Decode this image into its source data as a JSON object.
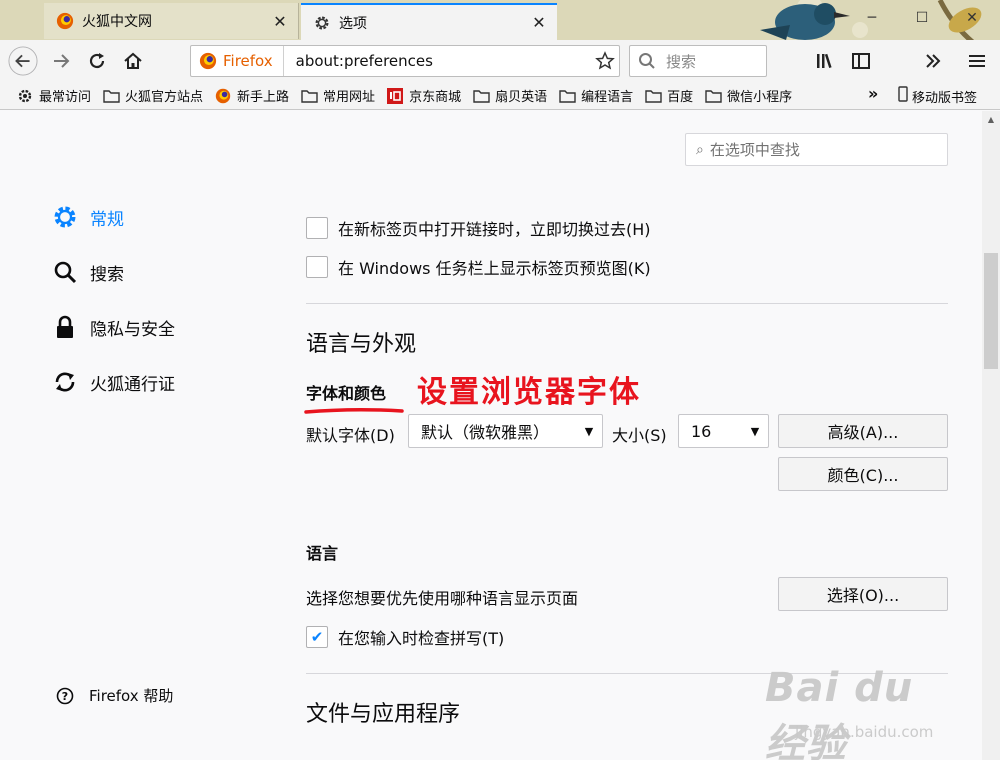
{
  "tabs": [
    {
      "title": "火狐中文网",
      "close": "✕"
    },
    {
      "title": "选项",
      "close": "✕"
    }
  ],
  "newtab": "+",
  "window_controls": {
    "minimize": "─",
    "maximize": "☐",
    "close": "✕"
  },
  "urlbar": {
    "identity": "Firefox",
    "url": "about:preferences"
  },
  "searchbar": {
    "placeholder": "搜索"
  },
  "bookmarks": [
    {
      "label": "最常访问",
      "icon": "gear-icon"
    },
    {
      "label": "火狐官方站点",
      "icon": "folder-icon"
    },
    {
      "label": "新手上路",
      "icon": "firefox-icon"
    },
    {
      "label": "常用网址",
      "icon": "folder-icon"
    },
    {
      "label": "京东商城",
      "icon": "jd-icon"
    },
    {
      "label": "扇贝英语",
      "icon": "folder-icon"
    },
    {
      "label": "编程语言",
      "icon": "folder-icon"
    },
    {
      "label": "百度",
      "icon": "folder-icon"
    },
    {
      "label": "微信小程序",
      "icon": "folder-icon"
    }
  ],
  "bookmarks_overflow": "»",
  "mobile_bookmarks": "移动版书签",
  "find_placeholder": "在选项中查找",
  "sidebar": {
    "items": [
      {
        "label": "常规",
        "icon": "gear-icon",
        "selected": true
      },
      {
        "label": "搜索",
        "icon": "search-icon"
      },
      {
        "label": "隐私与安全",
        "icon": "lock-icon"
      },
      {
        "label": "火狐通行证",
        "icon": "sync-icon"
      }
    ],
    "help": "Firefox 帮助"
  },
  "tabs_section": {
    "switch_tab": "在新标签页中打开链接时，立即切换过去(H)",
    "taskbar_preview": "在 Windows 任务栏上显示标签页预览图(K)"
  },
  "language_appearance": {
    "title": "语言与外观",
    "fonts_heading": "字体和颜色",
    "annotation": "设置浏览器字体",
    "default_font_label": "默认字体(D)",
    "default_font_value": "默认（微软雅黑）",
    "size_label": "大小(S)",
    "size_value": "16",
    "advanced_button": "高级(A)...",
    "colors_button": "颜色(C)...",
    "language_heading": "语言",
    "language_desc": "选择您想要优先使用哪种语言显示页面",
    "choose_button": "选择(O)...",
    "spellcheck_label": "在您输入时检查拼写(T)",
    "spellcheck_checked": true
  },
  "files_section": {
    "title": "文件与应用程序"
  },
  "watermark": {
    "logo": "Bai du 经验",
    "sub": "jingyan.baidu.com"
  },
  "colors": {
    "accent": "#0a84ff",
    "annotation": "#e8141e",
    "firefox_orange": "#e66000"
  }
}
